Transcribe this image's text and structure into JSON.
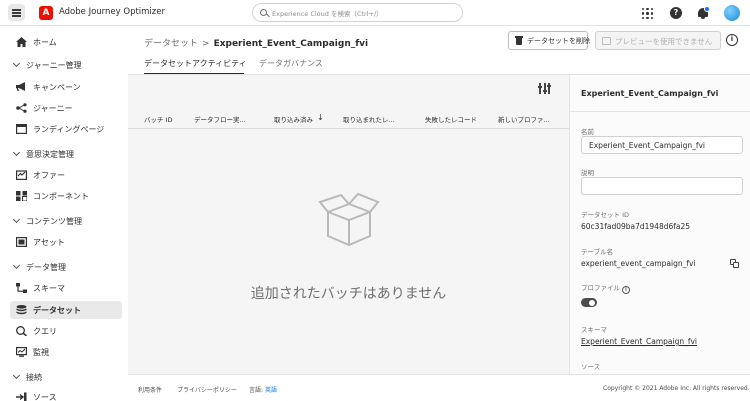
{
  "app": {
    "title": "Adobe Journey Optimizer",
    "logo_letter": "A",
    "search_placeholder": "Experience Cloud を検索（Ctrl+/）",
    "help_label": "?"
  },
  "sidebar": {
    "home": "ホーム",
    "groups": [
      {
        "label": "ジャーニー管理",
        "items": [
          "キャンペーン",
          "ジャーニー",
          "ランディングページ"
        ]
      },
      {
        "label": "意思決定管理",
        "items": [
          "オファー",
          "コンポーネント"
        ]
      },
      {
        "label": "コンテンツ管理",
        "items": [
          "アセット"
        ]
      },
      {
        "label": "データ管理",
        "items": [
          "スキーマ",
          "データセット",
          "クエリ",
          "監視"
        ]
      },
      {
        "label": "接続",
        "items": [
          "ソース"
        ]
      }
    ]
  },
  "header": {
    "breadcrumb_parent": "データセット",
    "breadcrumb_separator": ">",
    "breadcrumb_current": "Experient_Event_Campaign_fvi",
    "delete_label": "データセットを削除",
    "preview_label": "プレビューを使用できません",
    "info_label": "i"
  },
  "tabs": [
    "データセットアクティビティ",
    "データガバナンス"
  ],
  "table": {
    "columns": [
      "バッチ ID",
      "データフロー実...",
      "取り込み済み",
      "取り込まれたレ...",
      "失敗したレコード",
      "新しいプロファ..."
    ],
    "sort_indicator": "↓",
    "empty_message": "追加されたバッチはありません"
  },
  "rail": {
    "title": "Experient_Event_Campaign_fvi",
    "name_label": "名前",
    "name_value": "Experient_Event_Campaign_fvi",
    "description_label": "説明",
    "description_value": "",
    "dataset_id_label": "データセット ID",
    "dataset_id_value": "60c31fad09ba7d1948d6fa25",
    "table_name_label": "テーブル名",
    "table_name_value": "experient_event_campaign_fvi",
    "profile_label": "プロファイル",
    "profile_enabled": true,
    "schema_label": "スキーマ",
    "schema_value": "Experient_Event_Campaign_fvi",
    "source_label": "ソース"
  },
  "footer": {
    "terms": "利用条件",
    "privacy": "プライバシーポリシー",
    "language_label": "言語:",
    "language_value": "英語",
    "copyright": "Copyright © 2021 Adobe Inc.  All rights reserved."
  },
  "colors": {
    "brand": "#eb1000",
    "accent": "#1473e6",
    "active_nav": "#e9e9e9"
  }
}
